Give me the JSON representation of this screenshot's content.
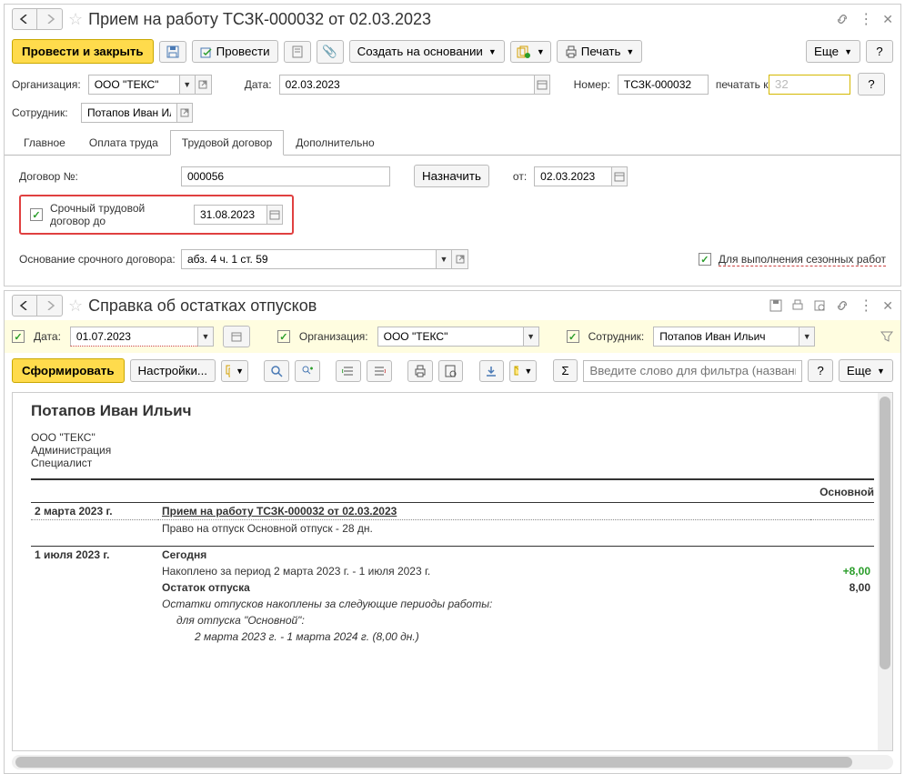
{
  "doc": {
    "title": "Прием на работу ТСЗК-000032 от 02.03.2023",
    "actions": {
      "post_close": "Провести и закрыть",
      "post": "Провести",
      "create_based": "Создать на основании",
      "print": "Печать",
      "more": "Еще"
    },
    "fields": {
      "org_label": "Организация:",
      "org_value": "ООО \"ТЕКС\"",
      "date_label": "Дата:",
      "date_value": "02.03.2023",
      "number_label": "Номер:",
      "number_value": "ТСЗК-000032",
      "print_as_label": "печатать как:",
      "print_as_value": "32",
      "employee_label": "Сотрудник:",
      "employee_value": "Потапов Иван Иль ..."
    },
    "tabs": {
      "main": "Главное",
      "pay": "Оплата труда",
      "contract": "Трудовой договор",
      "extra": "Дополнительно"
    },
    "contract": {
      "num_label": "Договор №:",
      "num_value": "000056",
      "assign": "Назначить",
      "from_label": "от:",
      "from_value": "02.03.2023",
      "urgent_label": "Срочный трудовой договор до",
      "urgent_value": "31.08.2023",
      "basis_label": "Основание срочного договора:",
      "basis_value": "абз. 4 ч. 1 ст. 59",
      "seasonal": "Для выполнения сезонных работ"
    }
  },
  "report": {
    "title": "Справка об остатках отпусков",
    "params": {
      "date_label": "Дата:",
      "date_value": "01.07.2023",
      "org_label": "Организация:",
      "org_value": "ООО \"ТЕКС\"",
      "emp_label": "Сотрудник:",
      "emp_value": "Потапов Иван Ильич"
    },
    "actions": {
      "run": "Сформировать",
      "settings": "Настройки...",
      "more": "Еще",
      "filter_placeholder": "Введите слово для фильтра (название товара..."
    },
    "body": {
      "name": "Потапов Иван Ильич",
      "org": "ООО \"ТЕКС\"",
      "dept": "Администрация",
      "pos": "Специалист",
      "group": "Основной",
      "d1_date": "2 марта 2023 г.",
      "d1_doc": "Прием на работу ТСЗК-000032 от 02.03.2023",
      "d1_right": "Право на отпуск Основной отпуск - 28 дн.",
      "d2_date": "1 июля 2023 г.",
      "d2_today": "Сегодня",
      "d2_accum": "Накоплено за период 2 марта 2023 г. - 1 июля 2023 г.",
      "d2_accum_val": "+8,00",
      "d2_rest": "Остаток отпуска",
      "d2_rest_val": "8,00",
      "note1": "Остатки отпусков накоплены за следующие периоды работы:",
      "note2": "для отпуска \"Основной\":",
      "note3": "2 марта 2023 г. - 1 марта 2024 г. (8,00 дн.)"
    }
  }
}
